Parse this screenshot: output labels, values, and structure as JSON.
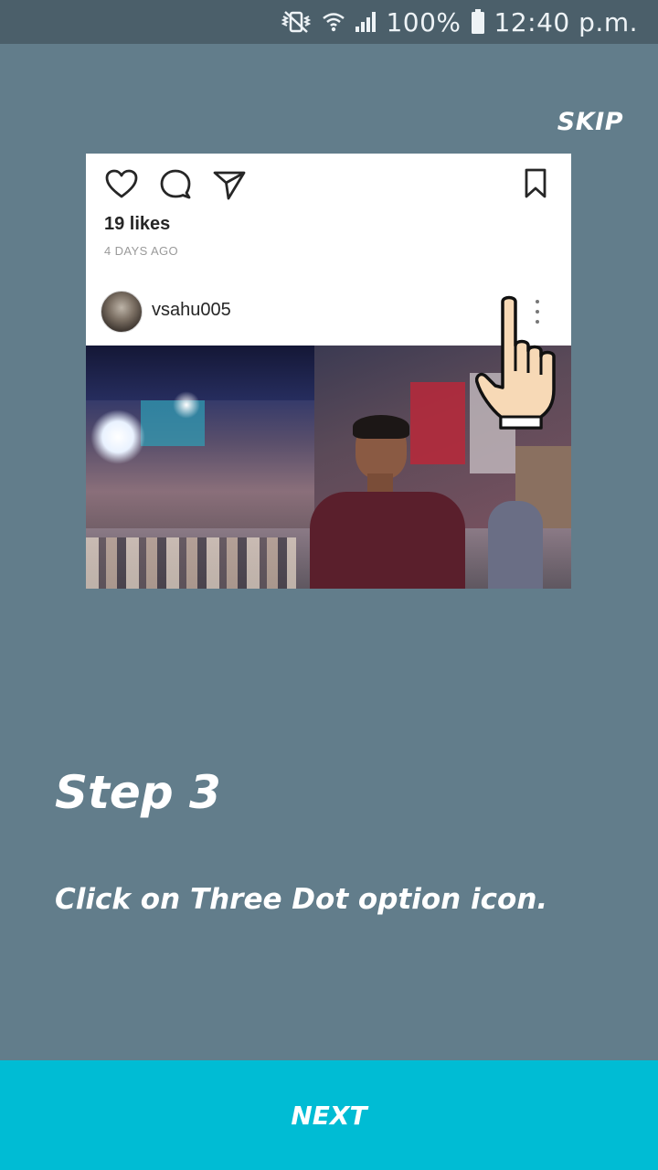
{
  "status_bar": {
    "icons": [
      "vibrate-mute-icon",
      "wifi-icon",
      "signal-icon",
      "battery-icon"
    ],
    "battery": "100%",
    "time": "12:40 p.m."
  },
  "skip_label": "SKIP",
  "post": {
    "likes": "19 likes",
    "time_ago": "4 DAYS AGO",
    "username": "vsahu005",
    "action_icons": [
      "heart-icon",
      "comment-icon",
      "share-icon",
      "bookmark-icon"
    ]
  },
  "step": {
    "title": "Step 3",
    "description": "Click on Three Dot option icon."
  },
  "next_label": "NEXT",
  "colors": {
    "background": "#627d8b",
    "status_bar": "#4b5f6a",
    "next_bar": "#00bcd4",
    "text": "#ffffff"
  }
}
